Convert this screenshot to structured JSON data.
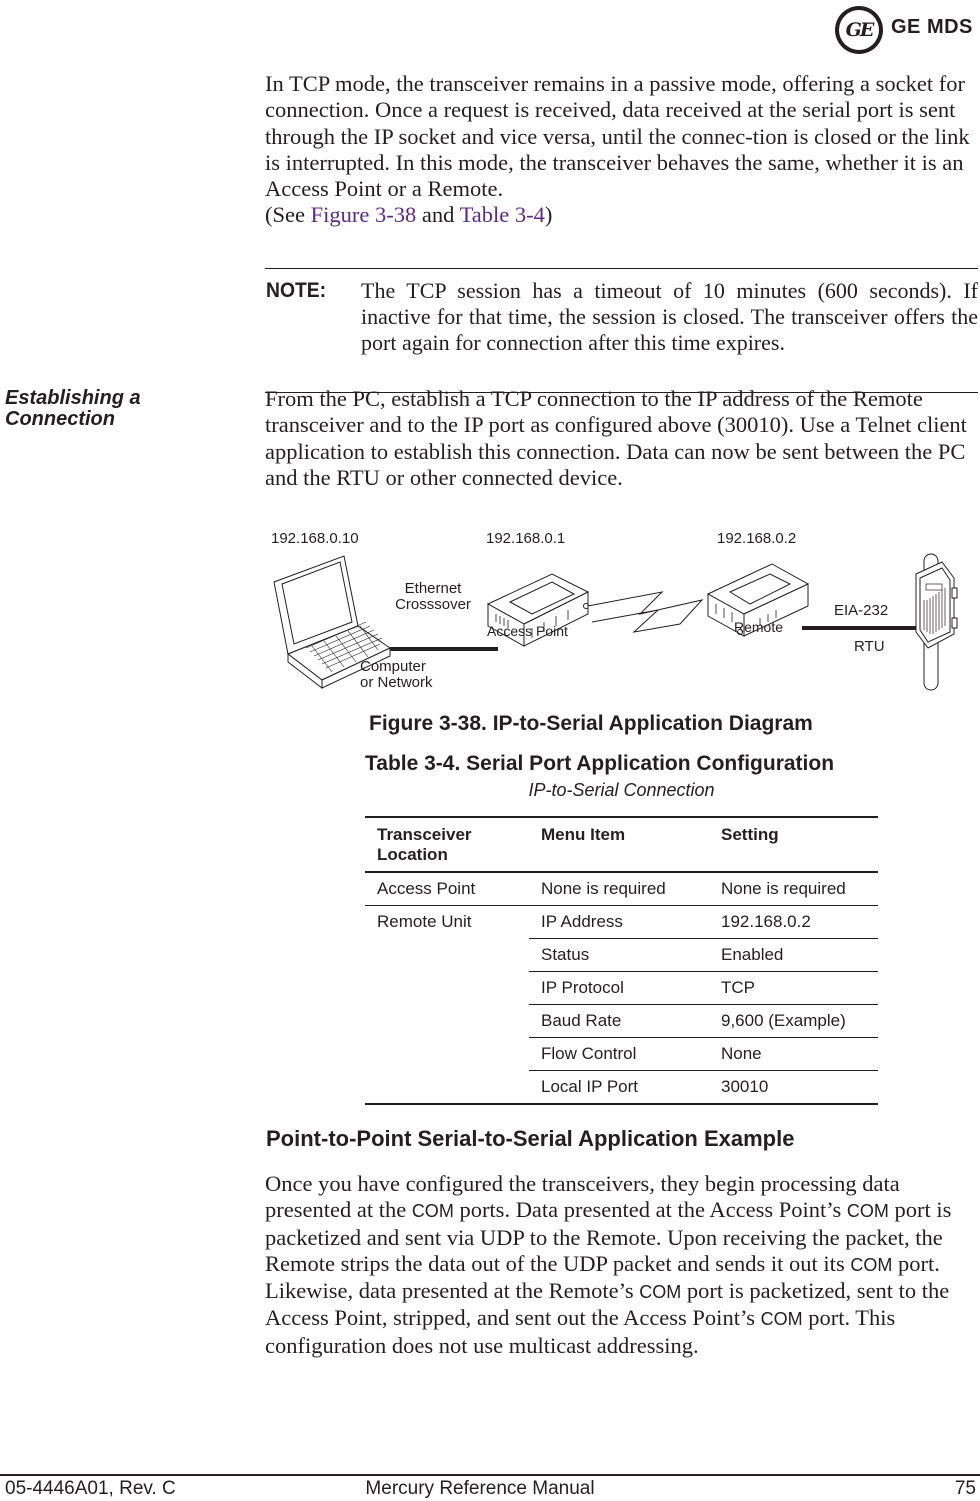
{
  "header": {
    "logo_mark": "GE",
    "logo_text": "GE MDS"
  },
  "intro": {
    "text": "In TCP mode, the transceiver remains in a passive mode, offering a socket for connection. Once a request is received, data received at the serial port is sent through the IP socket and vice versa, until the connec-tion is closed or the link is interrupted. In this mode, the transceiver behaves the same, whether it is an Access Point or a Remote.",
    "see_prefix": "(See ",
    "figure_ref": "Figure 3-38",
    "and": " and ",
    "table_ref": "Table 3-4",
    "see_suffix": ")",
    "xref_color": "#5b2a86"
  },
  "note": {
    "label": "NOTE:",
    "text": "The TCP session has a timeout of 10 minutes (600 seconds). If inactive for that time, the session is closed. The transceiver offers the port again for connection after this time expires."
  },
  "establishing": {
    "heading_line1": "Establishing a",
    "heading_line2": "Connection",
    "text": "From the PC, establish a TCP connection to the IP address of the Remote transceiver and to the IP port as configured above (30010). Use a Telnet client application to establish this connection. Data can now be sent between the PC and the RTU or other connected device."
  },
  "diagram": {
    "computer_ip": "192.168.0.10",
    "ap_ip": "192.168.0.1",
    "remote_ip": "192.168.0.2",
    "link1_line1": "Ethernet",
    "link1_line2": "Crosssover",
    "computer_line1": "Computer",
    "computer_line2": "or Network",
    "ap_label": "Access Point",
    "remote_label": "Remote",
    "link2_label": "EIA-232",
    "rtu_label": "RTU"
  },
  "figure_caption": "Figure 3-38. IP-to-Serial Application Diagram",
  "table": {
    "caption": "Table 3-4. Serial Port Application Configuration",
    "subcaption": "IP-to-Serial Connection",
    "headers": {
      "location_line1": "Transceiver",
      "location_line2": "Location",
      "menu": "Menu Item",
      "setting": "Setting"
    },
    "rows": [
      {
        "location": "Access Point",
        "menu": "None is required",
        "setting": "None is required"
      },
      {
        "location": "Remote Unit",
        "menu": "IP Address",
        "setting": "192.168.0.2"
      },
      {
        "location": "",
        "menu": "Status",
        "setting": "Enabled"
      },
      {
        "location": "",
        "menu": "IP Protocol",
        "setting": "TCP"
      },
      {
        "location": "",
        "menu": "Baud Rate",
        "setting": "9,600 (Example)"
      },
      {
        "location": "",
        "menu": "Flow Control",
        "setting": "None"
      },
      {
        "location": "",
        "menu": "Local IP Port",
        "setting": "30010"
      }
    ]
  },
  "p2p": {
    "heading": "Point-to-Point Serial-to-Serial Application Example",
    "t1": "Once you have configured the transceivers, they begin processing data presented at the ",
    "com": "COM",
    "t2": " ports. Data presented at the Access Point’s ",
    "t3": " port is packetized and sent via UDP to the Remote. Upon receiving the packet, the Remote strips the data out of the UDP packet and sends it out its ",
    "t4": " port. Likewise, data presented at the Remote’s ",
    "t5": " port is packetized, sent to the Access Point, stripped, and sent out the Access Point’s ",
    "t6": " port. This configuration does not use multicast addressing."
  },
  "footer": {
    "doc_id": "05-4446A01, Rev. C",
    "title": "Mercury Reference Manual",
    "page": "75"
  }
}
